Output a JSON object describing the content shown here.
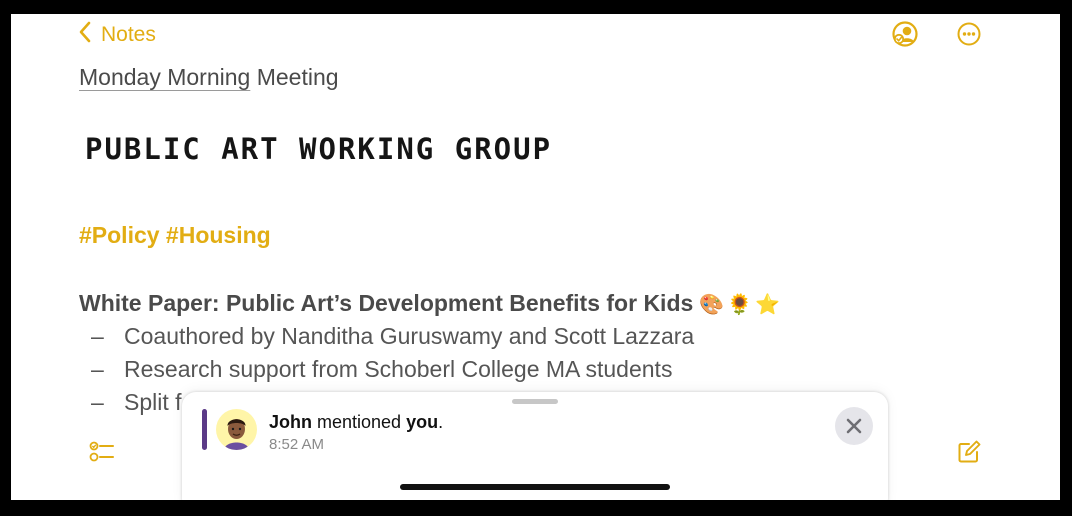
{
  "nav": {
    "back_label": "Notes",
    "back_icon": "chevron-left-icon",
    "collab_icon": "collaboration-icon",
    "more_icon": "ellipsis-circle-icon"
  },
  "note": {
    "title_link_text": "Monday Morning",
    "title_rest": " Meeting",
    "handwritten_title": "PUBLIC ART WORKING GROUP",
    "tags": "#Policy #Housing",
    "section_title": "White Paper: Public Art’s Development Benefits for Kids",
    "section_emojis": "🎨🌻⭐",
    "bullets": [
      {
        "dash": "–",
        "text": "Coauthored by Nanditha Guruswamy and Scott Lazzara"
      },
      {
        "dash": "–",
        "text": "Research support from Schoberl College MA students"
      },
      {
        "dash": "–",
        "text": "Split f"
      }
    ]
  },
  "toolbar": {
    "checklist_icon": "checklist-icon",
    "compose_icon": "compose-icon"
  },
  "notification": {
    "sender": "John",
    "action": " mentioned ",
    "target": "you",
    "punctuation": ".",
    "time": "8:52 AM",
    "close_icon": "close-icon"
  },
  "colors": {
    "accent": "#e2ad13",
    "mention_bar": "#5b3a87",
    "avatar_bg": "#fff5a8"
  }
}
